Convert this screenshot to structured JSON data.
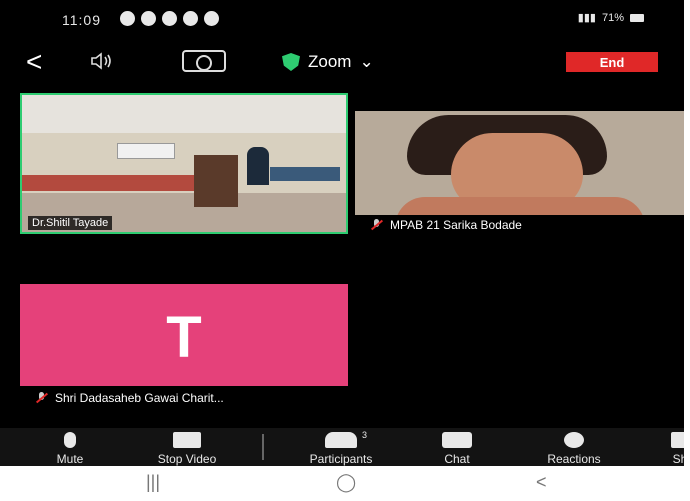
{
  "status_bar": {
    "time": "11:09",
    "battery": "71%"
  },
  "toolbar": {
    "back_glyph": "<",
    "meeting_name": "Zoom",
    "end_label": "End",
    "colors": {
      "end": "#e02828",
      "secure": "#2ecc71"
    }
  },
  "participants": [
    {
      "name": "Dr.Shitil Tayade",
      "active_speaker": true
    },
    {
      "name": "MPAB 21 Sarika Bodade",
      "muted": true
    },
    {
      "name": "Shri Dadasaheb Gawai Charit...",
      "initial": "T",
      "muted": true
    }
  ],
  "bottom_bar": {
    "mute": "Mute",
    "stop_video": "Stop Video",
    "participants": "Participants",
    "participants_count": "3",
    "chat": "Chat",
    "reactions": "Reactions",
    "share": "Sh"
  },
  "nav_bar": {
    "recent": "|||",
    "home": "◯",
    "back": "<"
  }
}
